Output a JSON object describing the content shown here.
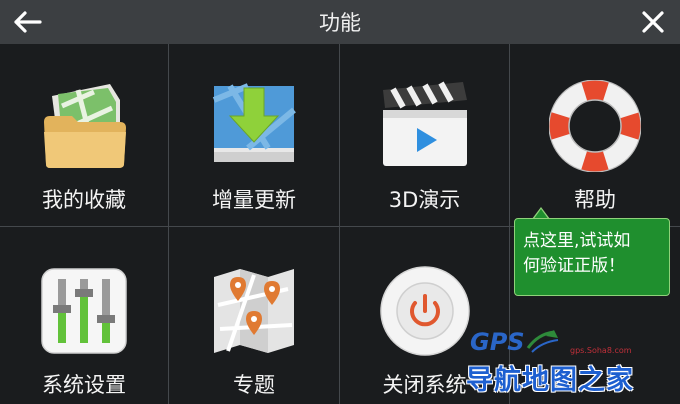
{
  "header": {
    "title": "功能",
    "back_icon": "back-arrow-icon",
    "close_icon": "close-icon"
  },
  "menu": {
    "items": [
      {
        "label": "我的收藏",
        "icon": "favorites-folder-icon"
      },
      {
        "label": "增量更新",
        "icon": "incremental-update-icon"
      },
      {
        "label": "3D演示",
        "icon": "3d-demo-video-icon"
      },
      {
        "label": "帮助",
        "icon": "lifebuoy-help-icon"
      },
      {
        "label": "系统设置",
        "icon": "settings-sliders-icon"
      },
      {
        "label": "专题",
        "icon": "topic-map-icon"
      },
      {
        "label": "关闭系统",
        "icon": "power-icon"
      }
    ]
  },
  "tooltip": {
    "line1": "点这里,试试如",
    "line2": "何验证正版！"
  },
  "watermark": {
    "brand": "GPS",
    "url": "gps.Soha8.com",
    "text": "导航地图之家"
  },
  "colors": {
    "header_bg": "#3c3f42",
    "page_bg": "#1a1c1e",
    "tooltip_bg": "#1f8f2e",
    "watermark_blue": "#1d5fd0"
  }
}
